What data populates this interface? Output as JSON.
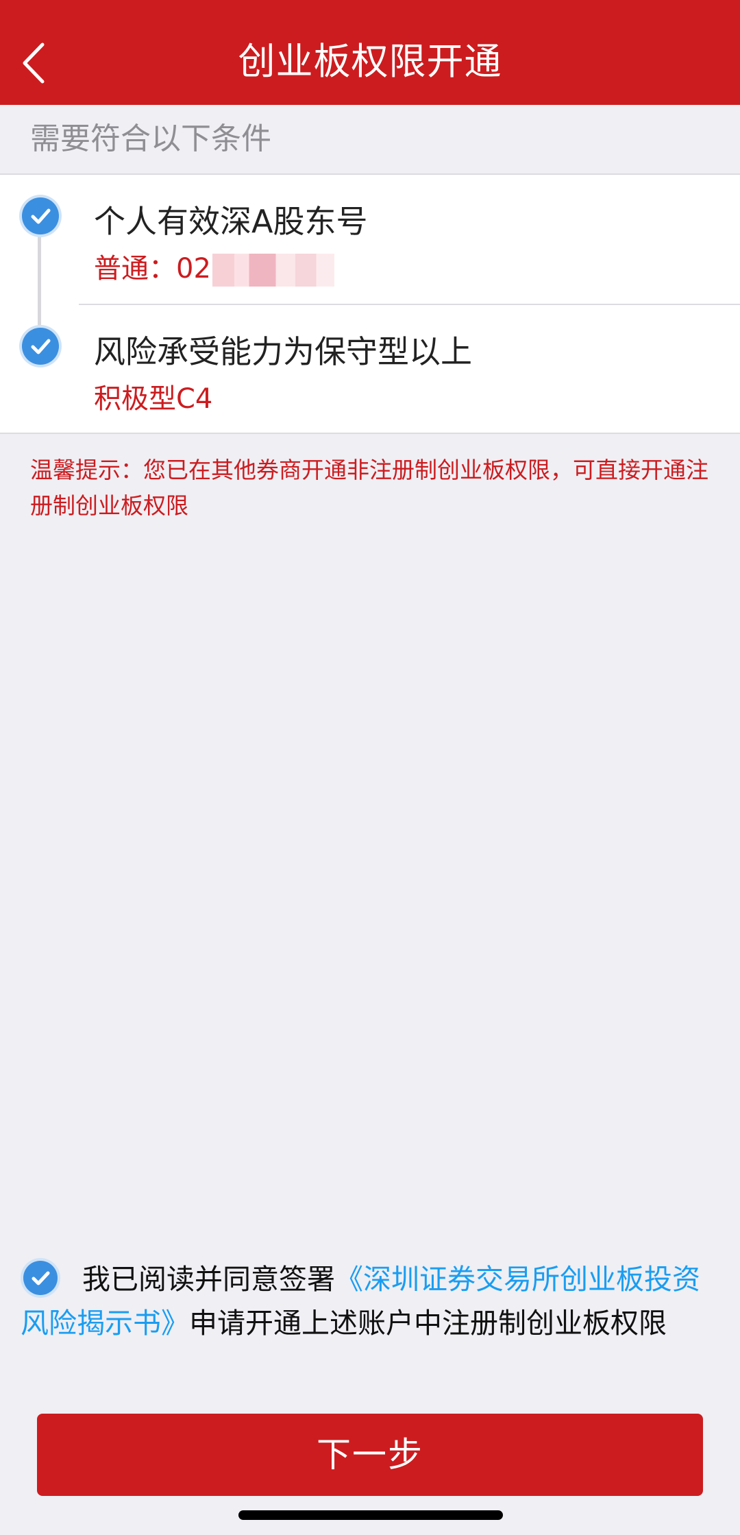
{
  "header": {
    "title": "创业板权限开通"
  },
  "section": {
    "title": "需要符合以下条件"
  },
  "conditions": [
    {
      "title": "个人有效深A股东号",
      "value": "普通：02",
      "checked": true
    },
    {
      "title": "风险承受能力为保守型以上",
      "value": "积极型C4",
      "checked": true
    }
  ],
  "tip": {
    "text": "温馨提示：您已在其他券商开通非注册制创业板权限，可直接开通注册制创业板权限"
  },
  "agreement": {
    "checked": true,
    "prefix": "我已阅读并同意签署",
    "link": "《深圳证券交易所创业板投资风险揭示书》",
    "suffix": "申请开通上述账户中注册制创业板权限"
  },
  "footer": {
    "next_label": "下一步"
  },
  "colors": {
    "brand_red": "#cc1c1f",
    "check_blue": "#3b8fe0",
    "link_blue": "#1a9df1",
    "background": "#efeff4"
  }
}
